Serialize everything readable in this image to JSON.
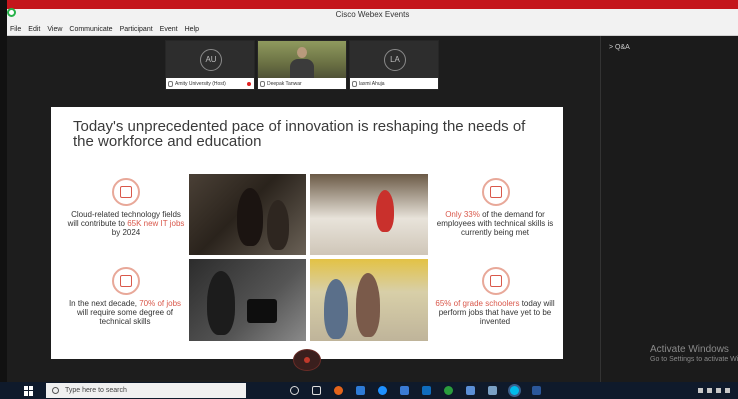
{
  "window": {
    "title": "Cisco Webex Events"
  },
  "menu": [
    "File",
    "Edit",
    "View",
    "Communicate",
    "Participant",
    "Event",
    "Help"
  ],
  "participants": [
    {
      "initials": "AU",
      "name": "Amity University (Host)"
    },
    {
      "initials": "",
      "name": "Deepak Tanwar"
    },
    {
      "initials": "LA",
      "name": "laxmi Ahuja"
    }
  ],
  "side_panel": {
    "qa_label": "> Q&A"
  },
  "slide": {
    "title": "Today's unprecedented pace of innovation is reshaping the needs of the workforce and education",
    "stats": {
      "cloud": {
        "pre": "Cloud-related technology fields will contribute to ",
        "highlight": "65K new IT jobs",
        "post": " by 2024"
      },
      "demand": {
        "pre": "",
        "highlight": "Only 33%",
        "post": " of the demand for employees with technical skills is currently being met"
      },
      "decade": {
        "pre": "In the next decade, ",
        "highlight": "70% of jobs",
        "post": " will require some degree of technical skills"
      },
      "grade": {
        "pre": "",
        "highlight": "65% of grade schoolers",
        "post": " today will perform jobs that have yet to be invented"
      }
    }
  },
  "watermark": {
    "line1": "Activate Windows",
    "line2": "Go to Settings to activate Windows."
  },
  "taskbar": {
    "search_placeholder": "Type here to search"
  },
  "colors": {
    "accent": "#d9584b",
    "title_strip": "#c4161c",
    "taskbar": "#0f1a2b"
  }
}
